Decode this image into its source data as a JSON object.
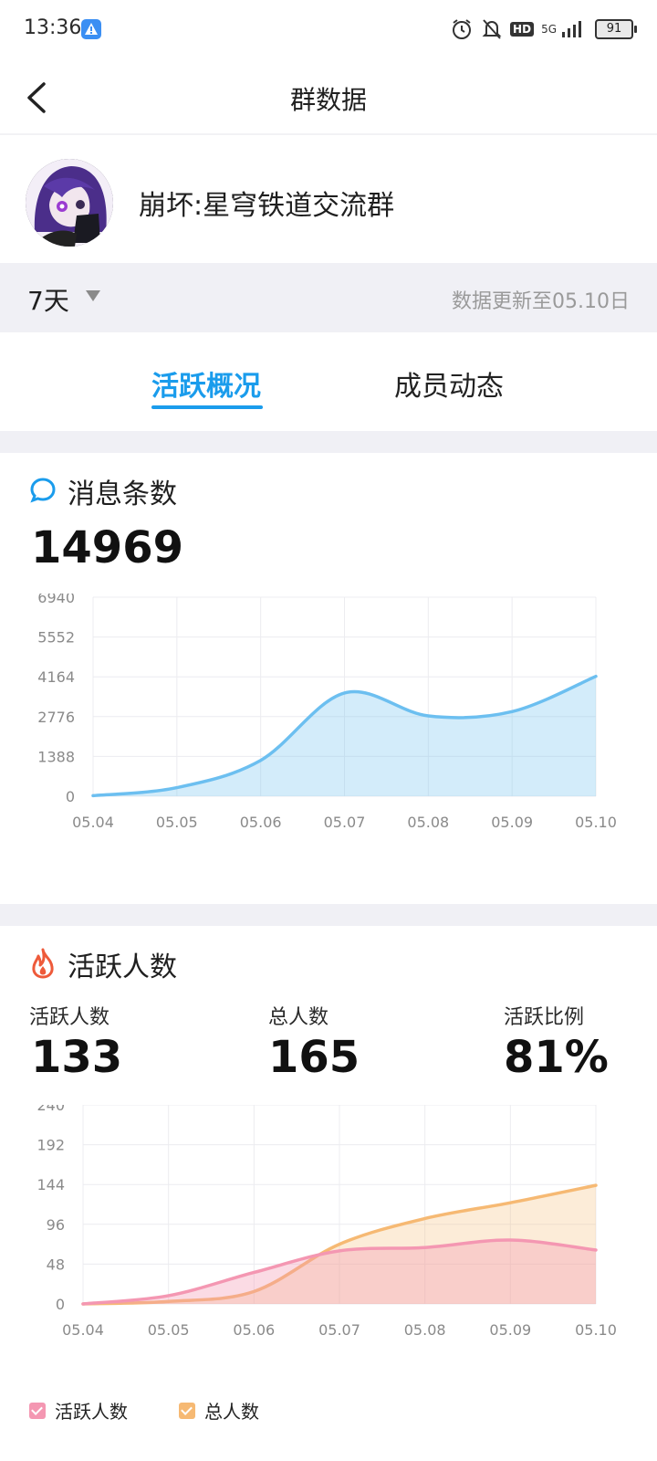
{
  "status_bar": {
    "time": "13:36",
    "network": "5G",
    "hd": "HD",
    "battery": "91"
  },
  "nav": {
    "title": "群数据"
  },
  "group": {
    "name": "崩坏:星穹铁道交流群"
  },
  "filter": {
    "range": "7天",
    "update_text": "数据更新至05.10日"
  },
  "tabs": [
    {
      "label": "活跃概况",
      "active": true
    },
    {
      "label": "成员动态",
      "active": false
    }
  ],
  "messages": {
    "title": "消息条数",
    "total": "14969",
    "chart_data": {
      "type": "area",
      "x": [
        "05.04",
        "05.05",
        "05.06",
        "05.07",
        "05.08",
        "05.09",
        "05.10"
      ],
      "y_ticks": [
        "6940",
        "5552",
        "4164",
        "2776",
        "1388",
        "0"
      ],
      "ylim": [
        0,
        6940
      ],
      "grid": true,
      "series": [
        {
          "values": [
            20,
            300,
            1250,
            3600,
            2800,
            2950,
            4180
          ],
          "color": "#6cbff0"
        }
      ]
    }
  },
  "active": {
    "title": "活跃人数",
    "stats": [
      {
        "label": "活跃人数",
        "value": "133"
      },
      {
        "label": "总人数",
        "value": "165"
      },
      {
        "label": "活跃比例",
        "value": "81%"
      }
    ],
    "chart_data": {
      "type": "area",
      "x": [
        "05.04",
        "05.05",
        "05.06",
        "05.07",
        "05.08",
        "05.09",
        "05.10"
      ],
      "y_ticks": [
        "240",
        "192",
        "144",
        "96",
        "48",
        "0"
      ],
      "ylim": [
        0,
        240
      ],
      "grid": true,
      "legend_position": "bottom-left",
      "series": [
        {
          "name": "活跃人数",
          "values": [
            0,
            10,
            38,
            64,
            68,
            77,
            65
          ],
          "color": "#f497b2"
        },
        {
          "name": "总人数",
          "values": [
            0,
            3,
            15,
            72,
            103,
            122,
            143
          ],
          "color": "#f6b973"
        }
      ]
    }
  }
}
